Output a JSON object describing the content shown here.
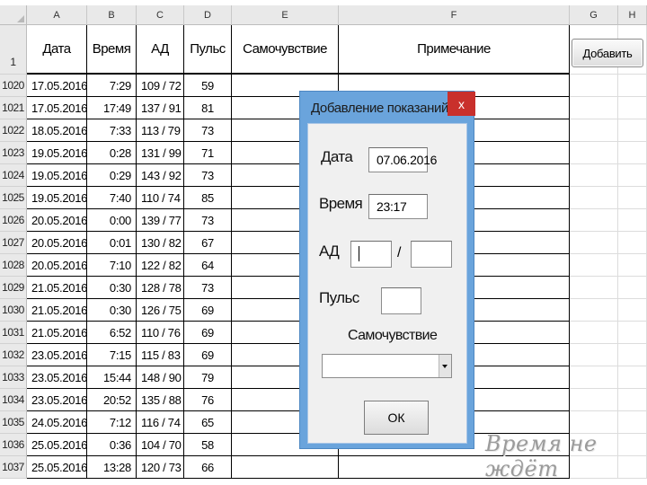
{
  "sheet": {
    "column_letters": [
      "A",
      "B",
      "C",
      "D",
      "E",
      "F",
      "G",
      "H"
    ],
    "header_row_number": "1",
    "headers": {
      "date": "Дата",
      "time": "Время",
      "bp": "АД",
      "pulse": "Пульс",
      "feeling": "Самочувствие",
      "note": "Примечание"
    },
    "rows": [
      {
        "n": "1020",
        "date": "17.05.2016",
        "time": "7:29",
        "bp": "109 / 72",
        "pulse": "59"
      },
      {
        "n": "1021",
        "date": "17.05.2016",
        "time": "17:49",
        "bp": "137 / 91",
        "pulse": "81"
      },
      {
        "n": "1022",
        "date": "18.05.2016",
        "time": "7:33",
        "bp": "113 / 79",
        "pulse": "73"
      },
      {
        "n": "1023",
        "date": "19.05.2016",
        "time": "0:28",
        "bp": "131 / 99",
        "pulse": "71"
      },
      {
        "n": "1024",
        "date": "19.05.2016",
        "time": "0:29",
        "bp": "143 / 92",
        "pulse": "73"
      },
      {
        "n": "1025",
        "date": "19.05.2016",
        "time": "7:40",
        "bp": "110 / 74",
        "pulse": "85"
      },
      {
        "n": "1026",
        "date": "20.05.2016",
        "time": "0:00",
        "bp": "139 / 77",
        "pulse": "73"
      },
      {
        "n": "1027",
        "date": "20.05.2016",
        "time": "0:01",
        "bp": "130 / 82",
        "pulse": "67"
      },
      {
        "n": "1028",
        "date": "20.05.2016",
        "time": "7:10",
        "bp": "122 / 82",
        "pulse": "64"
      },
      {
        "n": "1029",
        "date": "21.05.2016",
        "time": "0:30",
        "bp": "128 / 78",
        "pulse": "73"
      },
      {
        "n": "1030",
        "date": "21.05.2016",
        "time": "0:30",
        "bp": "126 / 75",
        "pulse": "69"
      },
      {
        "n": "1031",
        "date": "21.05.2016",
        "time": "6:52",
        "bp": "110 / 76",
        "pulse": "69"
      },
      {
        "n": "1032",
        "date": "23.05.2016",
        "time": "7:15",
        "bp": "115 / 83",
        "pulse": "69"
      },
      {
        "n": "1033",
        "date": "23.05.2016",
        "time": "15:44",
        "bp": "148 / 90",
        "pulse": "79"
      },
      {
        "n": "1034",
        "date": "23.05.2016",
        "time": "20:52",
        "bp": "135 / 88",
        "pulse": "76"
      },
      {
        "n": "1035",
        "date": "24.05.2016",
        "time": "7:12",
        "bp": "116 / 74",
        "pulse": "65"
      },
      {
        "n": "1036",
        "date": "25.05.2016",
        "time": "0:36",
        "bp": "104 / 70",
        "pulse": "58"
      },
      {
        "n": "1037",
        "date": "25.05.2016",
        "time": "13:28",
        "bp": "120 / 73",
        "pulse": "66"
      }
    ],
    "add_button_label": "Добавить"
  },
  "dialog": {
    "title": "Добавление показаний",
    "close_label": "x",
    "date_label": "Дата",
    "date_value": "07.06.2016",
    "time_label": "Время",
    "time_value": "23:17",
    "bp_label": "АД",
    "bp_separator": "/",
    "systolic_value": "",
    "diastolic_value": "",
    "pulse_label": "Пульс",
    "pulse_value": "",
    "feeling_label": "Самочувствие",
    "feeling_value": "",
    "ok_label": "ОК"
  },
  "watermark": "Время не ждёт",
  "colors": {
    "dialog_frame": "#6aa4dc",
    "close_button": "#c9302c",
    "header_bg": "#e9e9e9"
  }
}
